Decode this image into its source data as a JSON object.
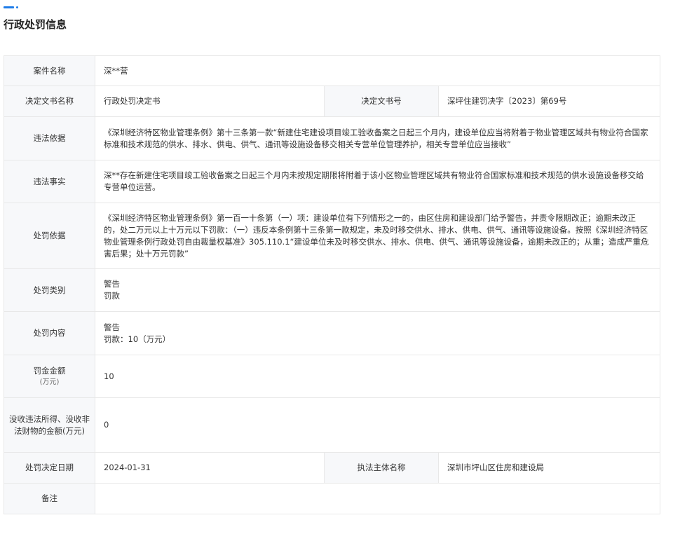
{
  "section": {
    "title": "行政处罚信息"
  },
  "rows": {
    "case_name": {
      "label": "案件名称",
      "value": "深**营"
    },
    "decision_doc": {
      "label": "决定文书名称",
      "value": "行政处罚决定书",
      "label2": "决定文书号",
      "value2": "深坪住建罚决字〔2023〕第69号"
    },
    "violation_basis": {
      "label": "违法依据",
      "value": "《深圳经济特区物业管理条例》第十三条第一款“新建住宅建设项目竣工验收备案之日起三个月内，建设单位应当将附着于物业管理区域共有物业符合国家标准和技术规范的供水、排水、供电、供气、通讯等设施设备移交相关专营单位管理养护，相关专营单位应当接收”"
    },
    "violation_facts": {
      "label": "违法事实",
      "value": "深**存在新建住宅项目竣工验收备案之日起三个月内未按规定期限将附着于该小区物业管理区域共有物业符合国家标准和技术规范的供水设施设备移交给专营单位运营。"
    },
    "penalty_basis": {
      "label": "处罚依据",
      "value": "《深圳经济特区物业管理条例》第一百一十条第（一）项：建设单位有下列情形之一的，由区住房和建设部门给予警告，并责令限期改正；逾期未改正的，处二万元以上十万元以下罚款：（一）违反本条例第十三条第一款规定，未及时移交供水、排水、供电、供气、通讯等设施设备。按照《深圳经济特区物业管理条例行政处罚自由裁量权基准》305.110.1“建设单位未及时移交供水、排水、供电、供气、通讯等设施设备，逾期未改正的；从重；造成严重危害后果；处十万元罚款”"
    },
    "penalty_category": {
      "label": "处罚类别",
      "line1": "警告",
      "line2": "罚款"
    },
    "penalty_content": {
      "label": "处罚内容",
      "line1": "警告",
      "line2": "罚款：10（万元）"
    },
    "fine_amount": {
      "label": "罚金金额",
      "unit": "(万元)",
      "value": "10"
    },
    "confiscation": {
      "label": "没收违法所得、没收非法财物的金额(万元)",
      "value": "0"
    },
    "decision_date": {
      "label": "处罚决定日期",
      "value": "2024-01-31",
      "label2": "执法主体名称",
      "value2": "深圳市坪山区住房和建设局"
    },
    "remarks": {
      "label": "备注",
      "value": ""
    }
  }
}
